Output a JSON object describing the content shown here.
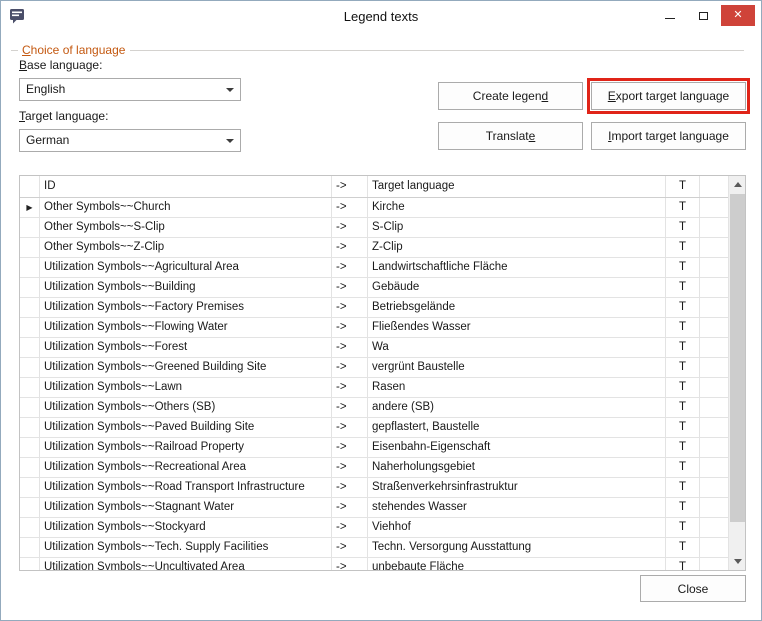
{
  "window": {
    "title": "Legend texts"
  },
  "group": {
    "label": {
      "pre": "",
      "key": "C",
      "post": "hoice of language"
    }
  },
  "language": {
    "base_label": {
      "pre": "",
      "key": "B",
      "post": "ase language:"
    },
    "base_value": "English",
    "target_label": {
      "pre": "",
      "key": "T",
      "post": "arget language:"
    },
    "target_value": "German"
  },
  "buttons": {
    "create_legend": {
      "pre": "Create legen",
      "key": "d",
      "post": ""
    },
    "export_target": {
      "pre": "",
      "key": "E",
      "post": "xport target language"
    },
    "translate": {
      "pre": "Translat",
      "key": "e",
      "post": ""
    },
    "import_target": {
      "pre": "",
      "key": "I",
      "post": "mport target language"
    },
    "close": "Close"
  },
  "table": {
    "headers": {
      "indicator": "",
      "id": "ID",
      "arrow": "->",
      "target": "Target language",
      "t": "T"
    },
    "arrow_cell": "->",
    "t_cell": "T",
    "selected_indicator": "▶",
    "rows": [
      {
        "id": "Other Symbols~~Church",
        "target": "Kirche",
        "selected": true
      },
      {
        "id": "Other Symbols~~S-Clip",
        "target": "S-Clip"
      },
      {
        "id": "Other Symbols~~Z-Clip",
        "target": "Z-Clip"
      },
      {
        "id": "Utilization Symbols~~Agricultural Area",
        "target": "Landwirtschaftliche Fläche"
      },
      {
        "id": "Utilization Symbols~~Building",
        "target": "Gebäude"
      },
      {
        "id": "Utilization Symbols~~Factory Premises",
        "target": "Betriebsgelände"
      },
      {
        "id": "Utilization Symbols~~Flowing Water",
        "target": "Fließendes Wasser"
      },
      {
        "id": "Utilization Symbols~~Forest",
        "target": "Wa"
      },
      {
        "id": "Utilization Symbols~~Greened Building Site",
        "target": "vergrünt Baustelle"
      },
      {
        "id": "Utilization Symbols~~Lawn",
        "target": "Rasen"
      },
      {
        "id": "Utilization Symbols~~Others (SB)",
        "target": "andere (SB)"
      },
      {
        "id": "Utilization Symbols~~Paved Building Site",
        "target": "gepflastert, Baustelle"
      },
      {
        "id": "Utilization Symbols~~Railroad Property",
        "target": "Eisenbahn-Eigenschaft"
      },
      {
        "id": "Utilization Symbols~~Recreational Area",
        "target": "Naherholungsgebiet"
      },
      {
        "id": "Utilization Symbols~~Road Transport Infrastructure",
        "target": "Straßenverkehrsinfrastruktur"
      },
      {
        "id": "Utilization Symbols~~Stagnant Water",
        "target": "stehendes Wasser"
      },
      {
        "id": "Utilization Symbols~~Stockyard",
        "target": "Viehhof"
      },
      {
        "id": "Utilization Symbols~~Tech. Supply Facilities",
        "target": "Techn. Versorgung Ausstattung"
      },
      {
        "id": "Utilization Symbols~~Uncultivated Area",
        "target": "unbebaute Fläche"
      }
    ]
  },
  "colors": {
    "group_label_orange": "#c45911",
    "export_highlight_red": "#e02418",
    "titlebar_close_red": "#cf4339",
    "border_gray": "#ababab"
  }
}
